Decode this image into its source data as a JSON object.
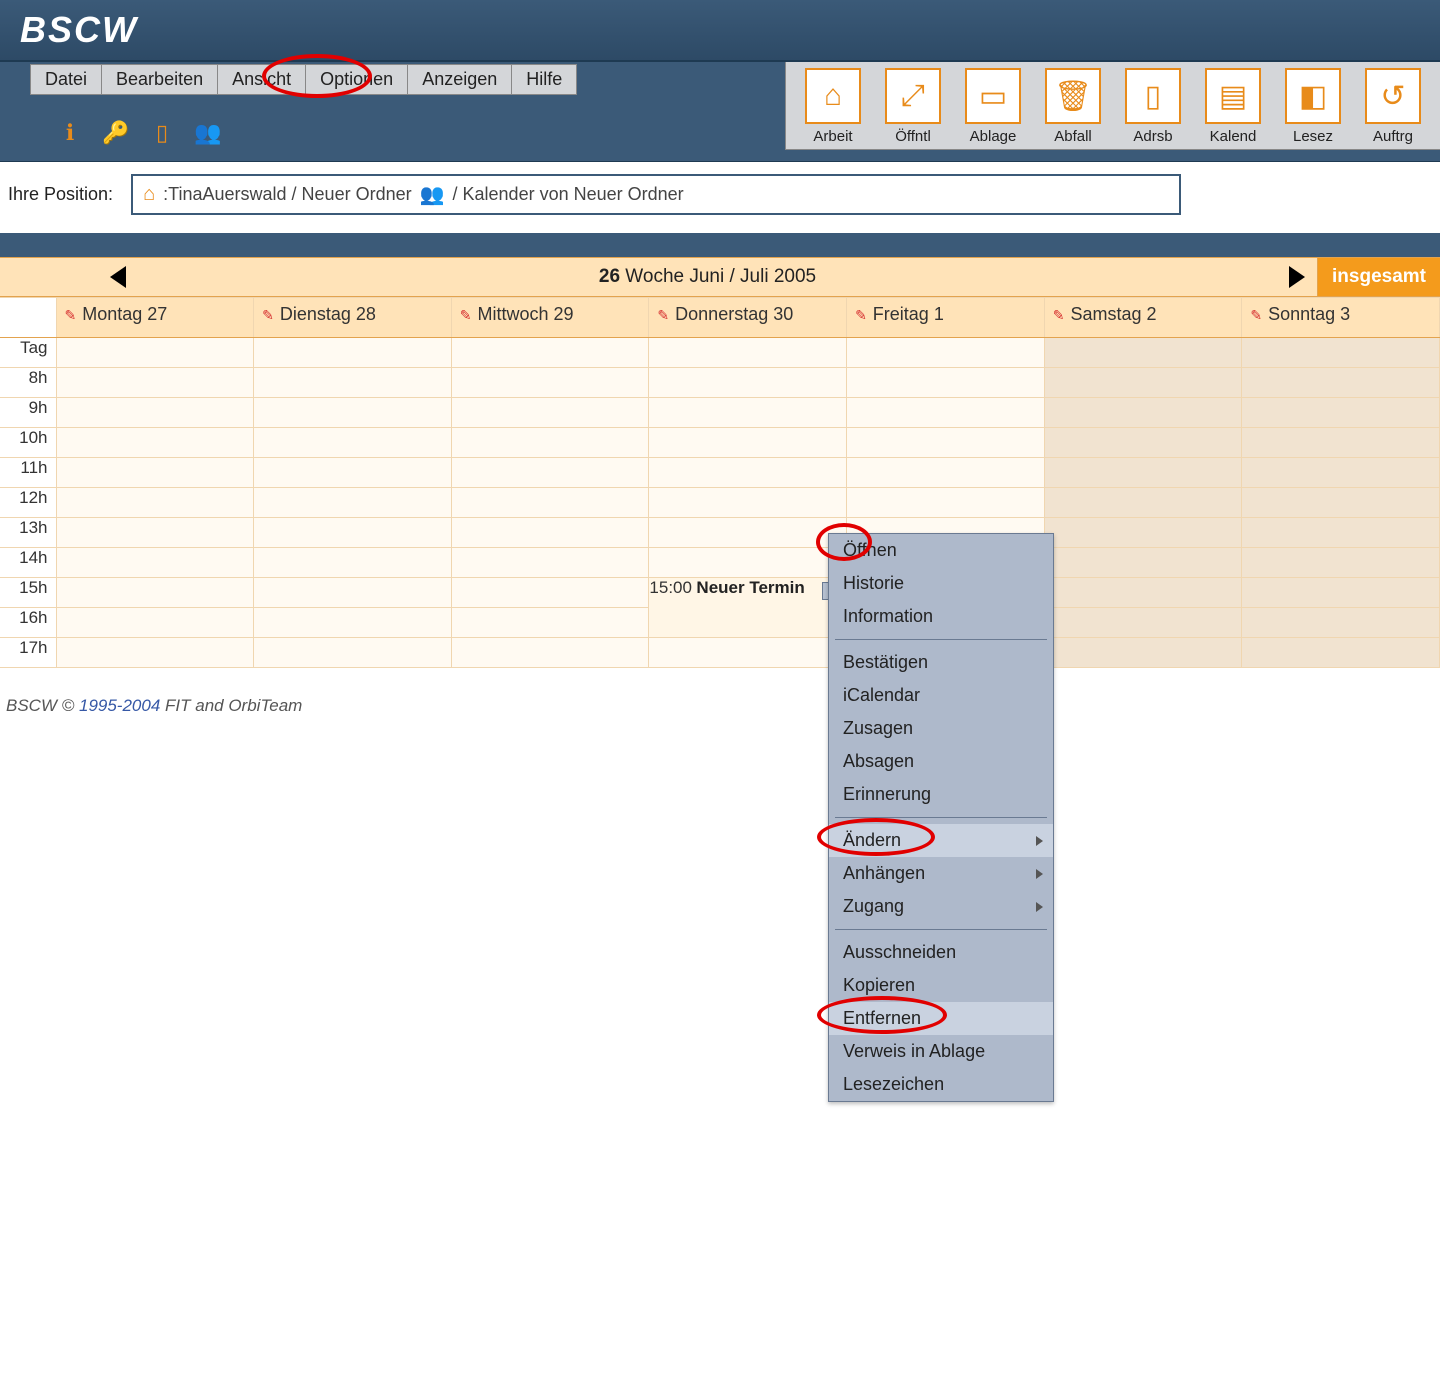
{
  "logo": "BSCW",
  "menubar": [
    "Datei",
    "Bearbeiten",
    "Ansicht",
    "Optionen",
    "Anzeigen",
    "Hilfe"
  ],
  "mini_icons": [
    "info-icon",
    "key-icon",
    "note-icon",
    "people-icon"
  ],
  "toolbar": [
    {
      "label": "Arbeit",
      "name": "tool-home-icon",
      "glyph": "⌂"
    },
    {
      "label": "Öffntl",
      "name": "tool-public-icon",
      "glyph": "⤢"
    },
    {
      "label": "Ablage",
      "name": "tool-clipboard-icon",
      "glyph": "▭"
    },
    {
      "label": "Abfall",
      "name": "tool-trash-icon",
      "glyph": "🗑"
    },
    {
      "label": "Adrsb",
      "name": "tool-addressbook-icon",
      "glyph": "▯"
    },
    {
      "label": "Kalend",
      "name": "tool-calendar-icon",
      "glyph": "▤"
    },
    {
      "label": "Lesez",
      "name": "tool-bookmark-icon",
      "glyph": "◧"
    },
    {
      "label": "Auftrg",
      "name": "tool-task-icon",
      "glyph": "↺"
    }
  ],
  "breadcrumb": {
    "label": "Ihre Position:",
    "path1": ":TinaAuerswald / Neuer Ordner",
    "path2": "/ Kalender von Neuer Ordner"
  },
  "weeknav": {
    "week_no": "26",
    "range": "Woche Juni / Juli 2005",
    "total_label": "insgesamt"
  },
  "days": [
    {
      "label": "Montag 27",
      "weekend": false
    },
    {
      "label": "Dienstag 28",
      "weekend": false
    },
    {
      "label": "Mittwoch 29",
      "weekend": false
    },
    {
      "label": "Donnerstag 30",
      "weekend": false
    },
    {
      "label": "Freitag 1",
      "weekend": false
    },
    {
      "label": "Samstag 2",
      "weekend": true
    },
    {
      "label": "Sonntag 3",
      "weekend": true
    }
  ],
  "allday_label": "Tag",
  "hours": [
    "8h",
    "9h",
    "10h",
    "11h",
    "12h",
    "13h",
    "14h",
    "15h",
    "16h",
    "17h"
  ],
  "event": {
    "day_index": 3,
    "hour_index": 7,
    "time": "15:00",
    "title": "Neuer Termin"
  },
  "context_menu": {
    "groups": [
      [
        "Öffnen",
        "Historie",
        "Information"
      ],
      [
        "Bestätigen",
        "iCalendar",
        "Zusagen",
        "Absagen",
        "Erinnerung"
      ],
      [
        {
          "t": "Ändern",
          "sub": true
        },
        {
          "t": "Anhängen",
          "sub": true
        },
        {
          "t": "Zugang",
          "sub": true
        }
      ],
      [
        "Ausschneiden",
        "Kopieren",
        "Entfernen",
        "Verweis in Ablage",
        "Lesezeichen"
      ]
    ],
    "highlighted": [
      "Ändern",
      "Entfernen"
    ]
  },
  "footer": {
    "pre": "BSCW © ",
    "link": "1995-2004",
    "post": " FIT and OrbiTeam"
  }
}
